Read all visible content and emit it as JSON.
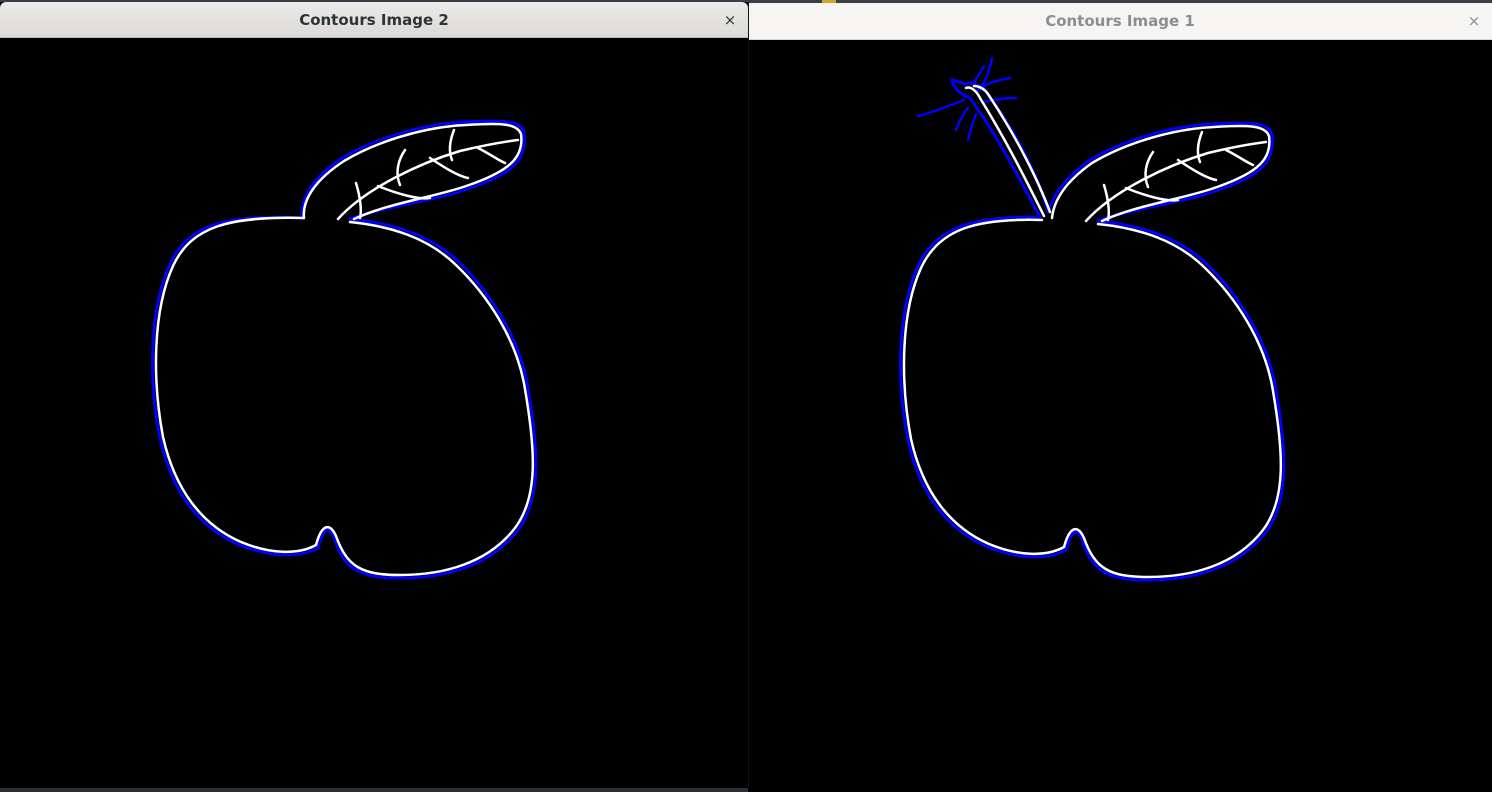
{
  "colors": {
    "contour": "#0000ff",
    "drawing": "#ffffff",
    "background": "#000000"
  },
  "windows": [
    {
      "title": "Contours Image 2",
      "state": "active",
      "close_icon": "close-icon",
      "content": "apple-with-leaf-outline"
    },
    {
      "title": "Contours Image 1",
      "state": "inactive",
      "close_icon": "close-icon",
      "content": "apple-with-leaf-and-stem-outline"
    }
  ],
  "close_glyph": "×"
}
